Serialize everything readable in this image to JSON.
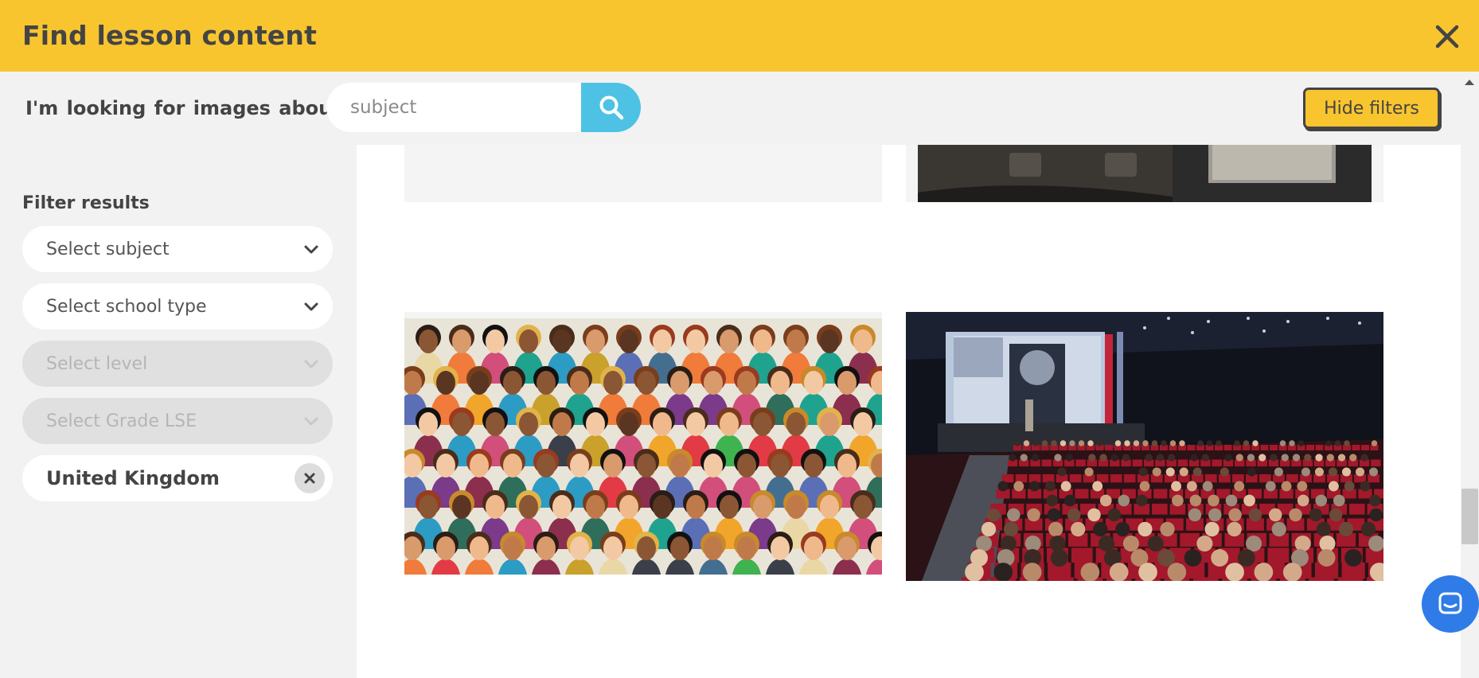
{
  "header": {
    "title": "Find lesson content",
    "close_icon": "close-icon"
  },
  "search": {
    "label": "I'm looking for images about",
    "placeholder": "subject",
    "button_icon": "search-icon",
    "hide_filters_label": "Hide filters"
  },
  "filters": {
    "title": "Filter results",
    "subject": "Select subject",
    "school_type": "Select school type",
    "level": "Select level",
    "grade": "Select Grade LSE",
    "country": "United Kingdom"
  },
  "results": {
    "cards": [
      {
        "name": "result-image-top-left"
      },
      {
        "name": "result-image-top-right"
      },
      {
        "name": "result-image-crowd-illustration"
      },
      {
        "name": "result-image-cinema-audience"
      }
    ]
  },
  "colors": {
    "accent": "#f8c52f",
    "search_button": "#4ec2e5",
    "chat": "#2f7be8"
  },
  "chat": {
    "icon": "chat-icon"
  }
}
